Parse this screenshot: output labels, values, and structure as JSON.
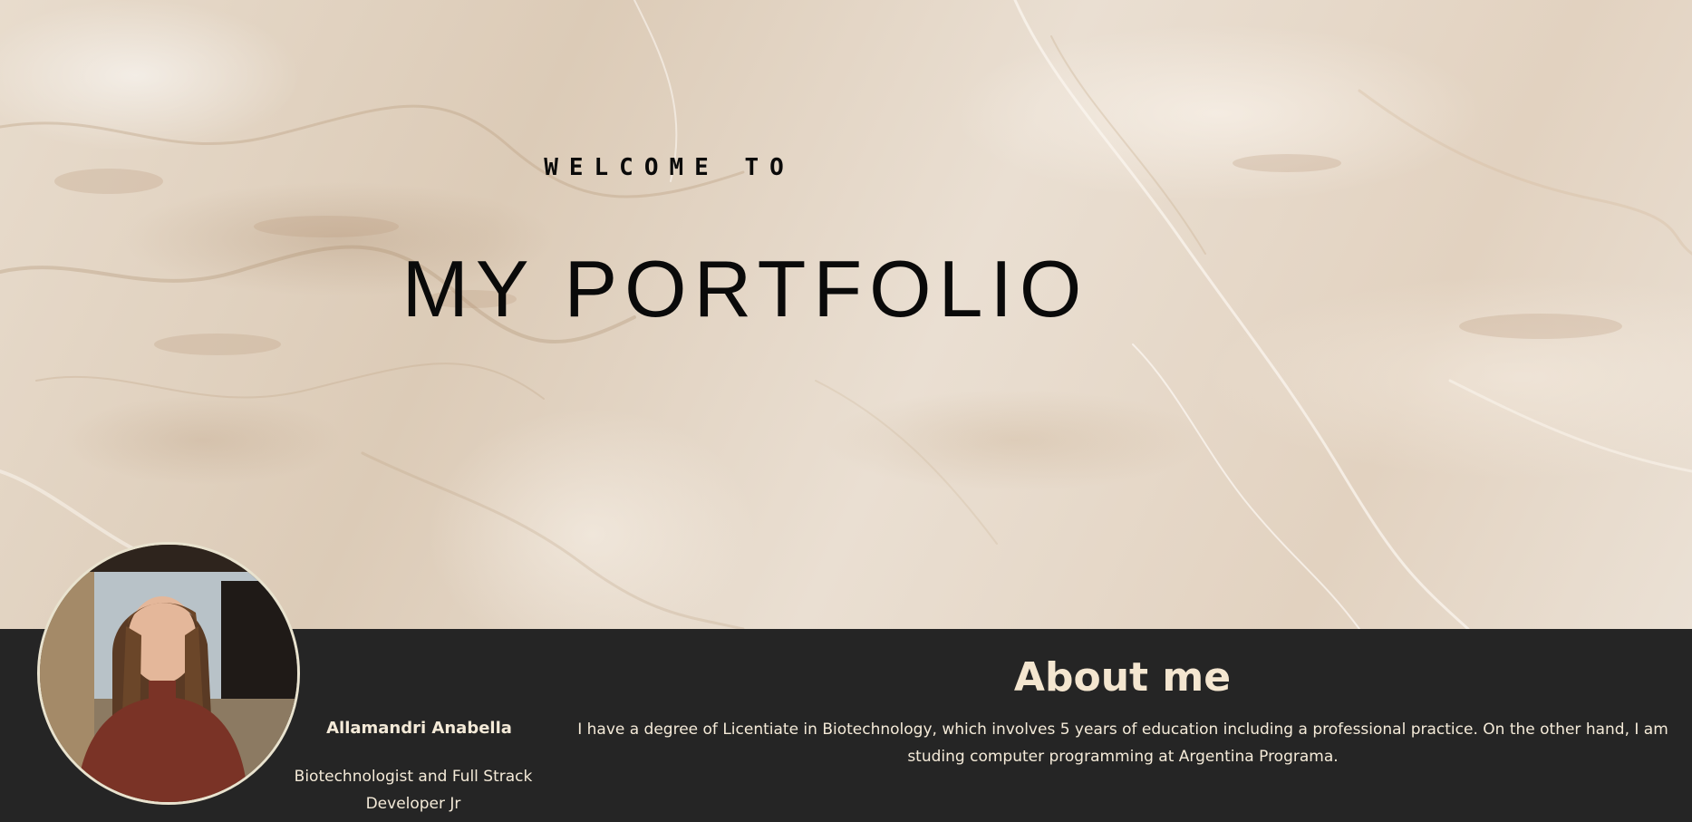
{
  "hero": {
    "welcome": "WELCOME TO",
    "title": "MY PORTFOLIO"
  },
  "profile": {
    "name": "Allamandri Anabella",
    "role": "Biotechnologist and Full Strack Developer Jr"
  },
  "about": {
    "heading": "About me",
    "text": "I have a degree of Licentiate in Biotechnology, which involves 5 years of education including a professional practice. On the other hand, I am studing computer programming at Argentina Programa."
  },
  "colors": {
    "footer_background": "#252525",
    "accent_text": "#f4e6d0",
    "hero_text": "#0a0a0a",
    "marble_base": "#e4d7c8"
  }
}
